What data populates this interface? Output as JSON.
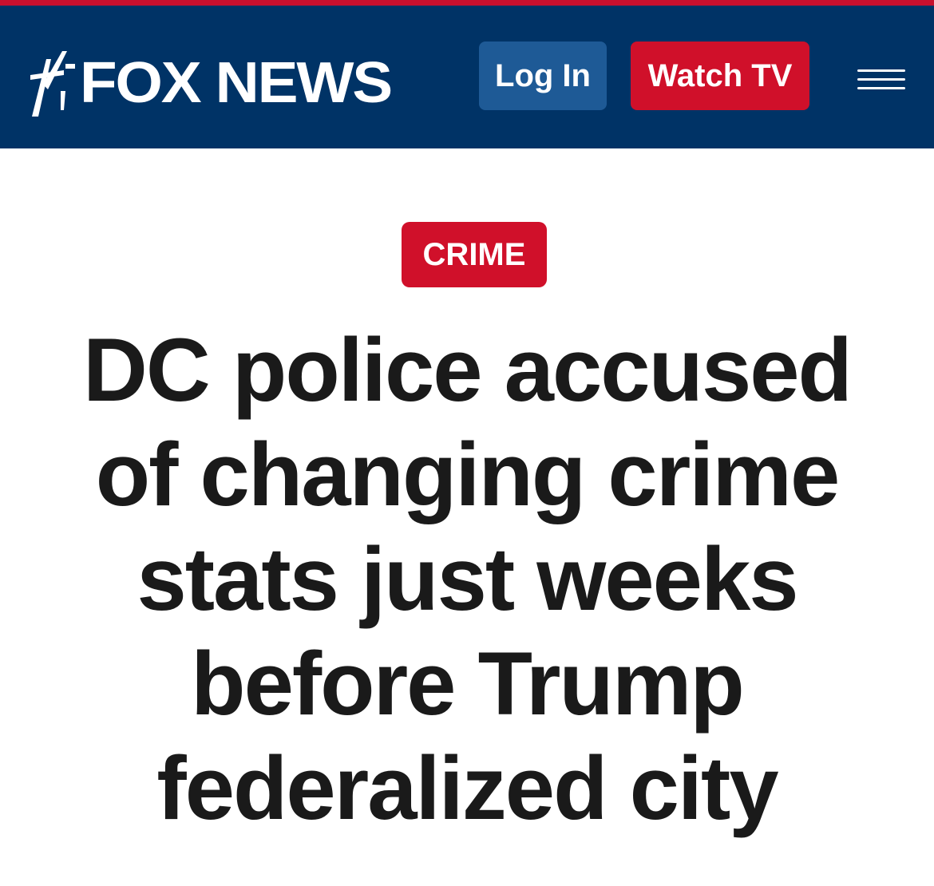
{
  "header": {
    "logo_text": "FOX NEWS",
    "login_label": "Log In",
    "watch_label": "Watch TV",
    "menu_icon": "hamburger-menu-icon",
    "logo_icon": "fox-news-logo-icon"
  },
  "article": {
    "category": "CRIME",
    "headline": "DC police accused of changing crime stats just weeks before Trump federalized city"
  },
  "colors": {
    "header_bg": "#003366",
    "top_stripe": "#c8102e",
    "login_bg": "#1e5a96",
    "watch_bg": "#d0102a",
    "badge_bg": "#d0102a",
    "headline_text": "#1a1a1a"
  }
}
